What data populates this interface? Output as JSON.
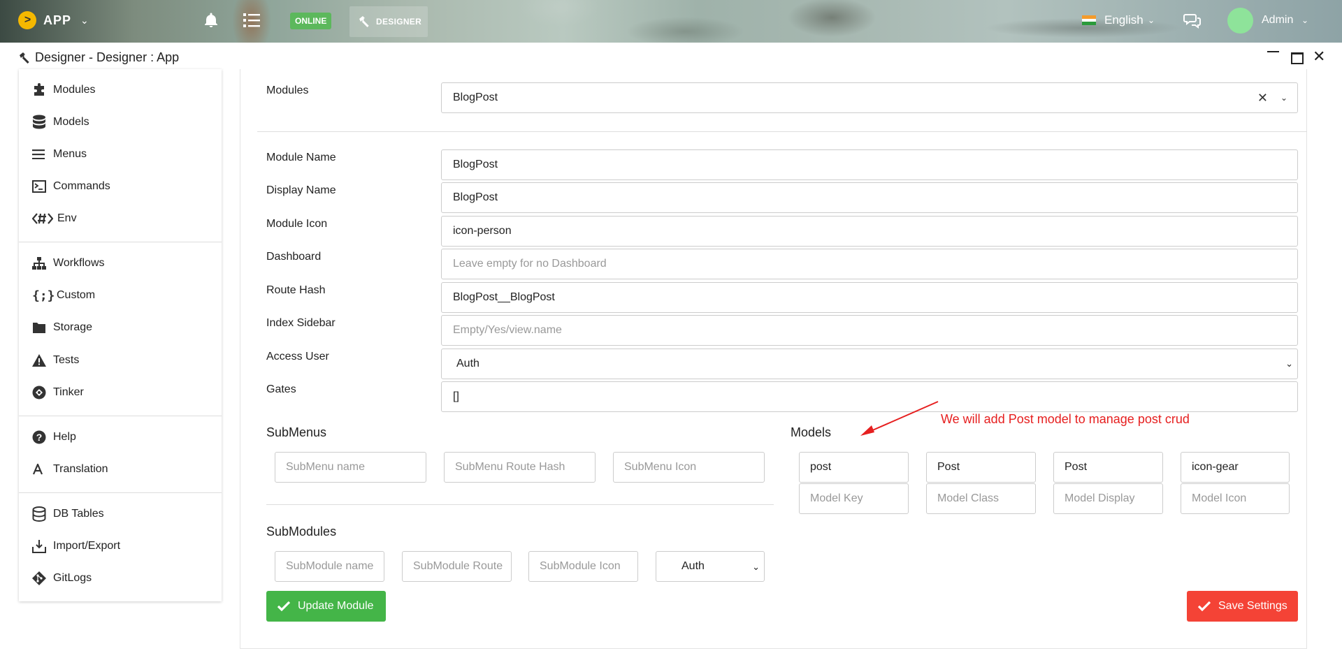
{
  "topbar": {
    "app_title": "APP",
    "online_badge": "ONLINE",
    "designer_tab": "DESIGNER",
    "language": "English",
    "user": "Admin",
    "icons": [
      "app-logo-icon",
      "bell-icon",
      "list-icon",
      "hammer-icon",
      "india-flag-icon",
      "chat-icon",
      "avatar"
    ]
  },
  "window": {
    "title": "Designer - Designer : App"
  },
  "sidebar": {
    "groups": [
      [
        {
          "label": "Modules",
          "icon": "puzzle-icon"
        },
        {
          "label": "Models",
          "icon": "database-icon"
        },
        {
          "label": "Menus",
          "icon": "menu-lines-icon"
        },
        {
          "label": "Commands",
          "icon": "terminal-icon"
        },
        {
          "label": "Env",
          "icon": "hashtag-code-icon"
        }
      ],
      [
        {
          "label": "Workflows",
          "icon": "sitemap-icon"
        },
        {
          "label": "Custom",
          "icon": "braces-icon"
        },
        {
          "label": "Storage",
          "icon": "folder-icon"
        },
        {
          "label": "Tests",
          "icon": "warning-icon"
        },
        {
          "label": "Tinker",
          "icon": "compass-icon"
        }
      ],
      [
        {
          "label": "Help",
          "icon": "help-icon"
        },
        {
          "label": "Translation",
          "icon": "translate-icon"
        }
      ],
      [
        {
          "label": "DB Tables",
          "icon": "database-icon"
        },
        {
          "label": "Import/Export",
          "icon": "import-export-icon"
        },
        {
          "label": "GitLogs",
          "icon": "git-icon"
        }
      ]
    ]
  },
  "form": {
    "modules_label": "Modules",
    "modules_value": "BlogPost",
    "fields": {
      "module_name": {
        "label": "Module Name",
        "value": "BlogPost"
      },
      "display_name": {
        "label": "Display Name",
        "value": "BlogPost"
      },
      "module_icon": {
        "label": "Module Icon",
        "value": "icon-person"
      },
      "dashboard": {
        "label": "Dashboard",
        "placeholder": "Leave empty for no Dashboard"
      },
      "route_hash": {
        "label": "Route Hash",
        "value": "BlogPost__BlogPost"
      },
      "index_sidebar": {
        "label": "Index Sidebar",
        "placeholder": "Empty/Yes/view.name"
      },
      "access_user": {
        "label": "Access User",
        "value": "Auth"
      },
      "gates": {
        "label": "Gates",
        "value": "[]"
      }
    }
  },
  "submenus": {
    "title": "SubMenus",
    "placeholders": [
      "SubMenu name",
      "SubMenu Route Hash",
      "SubMenu Icon"
    ]
  },
  "submodules": {
    "title": "SubModules",
    "placeholders": [
      "SubModule name",
      "SubModule Route",
      "SubModule Icon"
    ],
    "access_value": "Auth"
  },
  "models": {
    "title": "Models",
    "row": [
      "post",
      "Post",
      "Post",
      "icon-gear"
    ],
    "placeholders": [
      "Model Key",
      "Model Class",
      "Model Display",
      "Model Icon"
    ]
  },
  "annotation": "We will add Post model to manage post crud",
  "colors": {
    "online": "#5cb85c",
    "update_button": "#44b548",
    "save_button": "#f44336",
    "annotation": "#e61f1f",
    "app_logo": "#f5b800"
  },
  "buttons": {
    "update": "Update Module",
    "save": "Save Settings"
  }
}
